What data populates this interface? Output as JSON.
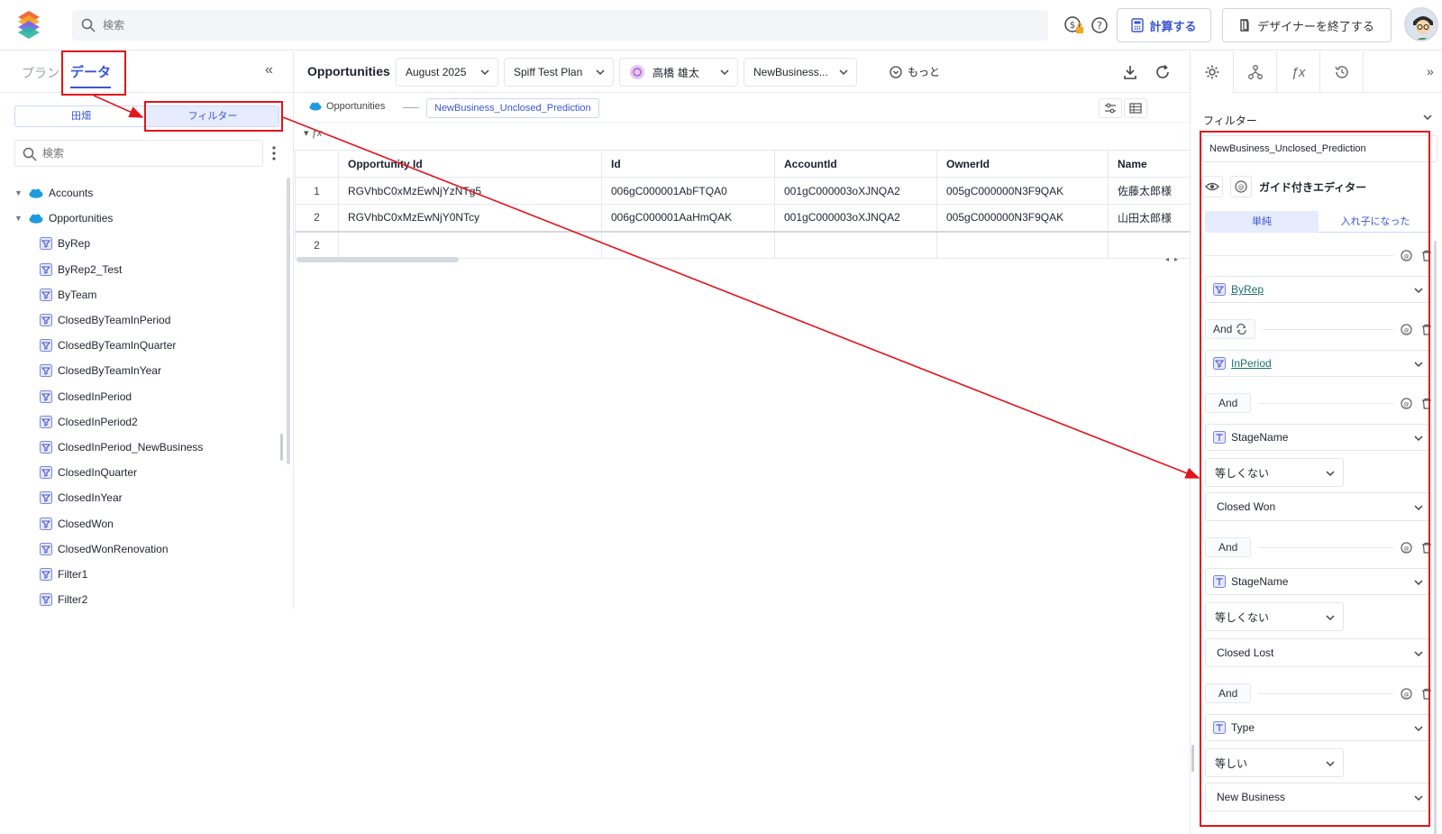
{
  "topbar": {
    "search_placeholder": "検索",
    "calc_label": "計算する",
    "exit_label": "デザイナーを終了する",
    "icons": [
      "logo-icon",
      "search-icon",
      "currency-lock-icon",
      "help-icon",
      "calculator-icon",
      "exit-icon",
      "avatar"
    ]
  },
  "left": {
    "tabs": {
      "plan": "プラン",
      "data": "データ"
    },
    "segments": {
      "fields": "田畑",
      "filters": "フィルター"
    },
    "search_placeholder": "検索",
    "tree": {
      "accounts": "Accounts",
      "opportunities": "Opportunities",
      "items": [
        "ByRep",
        "ByRep2_Test",
        "ByTeam",
        "ClosedByTeamInPeriod",
        "ClosedByTeamInQuarter",
        "ClosedByTeamInYear",
        "ClosedInPeriod",
        "ClosedInPeriod2",
        "ClosedInPeriod_NewBusiness",
        "ClosedInQuarter",
        "ClosedInYear",
        "ClosedWon",
        "ClosedWonRenovation",
        "Filter1",
        "Filter2"
      ]
    }
  },
  "center": {
    "title": "Opportunities",
    "period": "August 2025",
    "plan": "Spiff Test Plan",
    "user": "高橋 雄太",
    "filter": "NewBusiness...",
    "more": "もっと",
    "crumb_source": "Opportunities",
    "crumb_chip": "NewBusiness_Unclosed_Prediction",
    "fx_label": "ƒx",
    "table": {
      "headers": [
        "",
        "Opportunity Id",
        "Id",
        "AccountId",
        "OwnerId",
        "Name"
      ],
      "rows": [
        [
          "1",
          "RGVhbC0xMzEwNjYzNTg5",
          "006gC000001AbFTQA0",
          "001gC000003oXJNQA2",
          "005gC000000N3F9QAK",
          "佐藤太郎様"
        ],
        [
          "2",
          "RGVhbC0xMzEwNjY0NTcy",
          "006gC000001AaHmQAK",
          "001gC000003oXJNQA2",
          "005gC000000N3F9QAK",
          "山田太郎様"
        ],
        [
          "2",
          "",
          "",
          "",
          "",
          ""
        ]
      ]
    }
  },
  "right": {
    "section_title": "フィルター",
    "filter_name": "NewBusiness_Unclosed_Prediction",
    "guided_editor": "ガイド付きエディター",
    "mode_simple": "単純",
    "mode_nested": "入れ子になった",
    "and_label": "And",
    "conditions": {
      "byrep": "ByRep",
      "inperiod": "InPeriod",
      "stage1_field": "StageName",
      "stage1_op": "等しくない",
      "stage1_value": "Closed Won",
      "stage2_field": "StageName",
      "stage2_op": "等しくない",
      "stage2_value": "Closed Lost",
      "type_field": "Type",
      "type_op": "等しい",
      "type_value": "New Business"
    }
  },
  "colors": {
    "accent": "#3a56d4",
    "annotation": "#e3141b",
    "link": "#1f6f70"
  }
}
